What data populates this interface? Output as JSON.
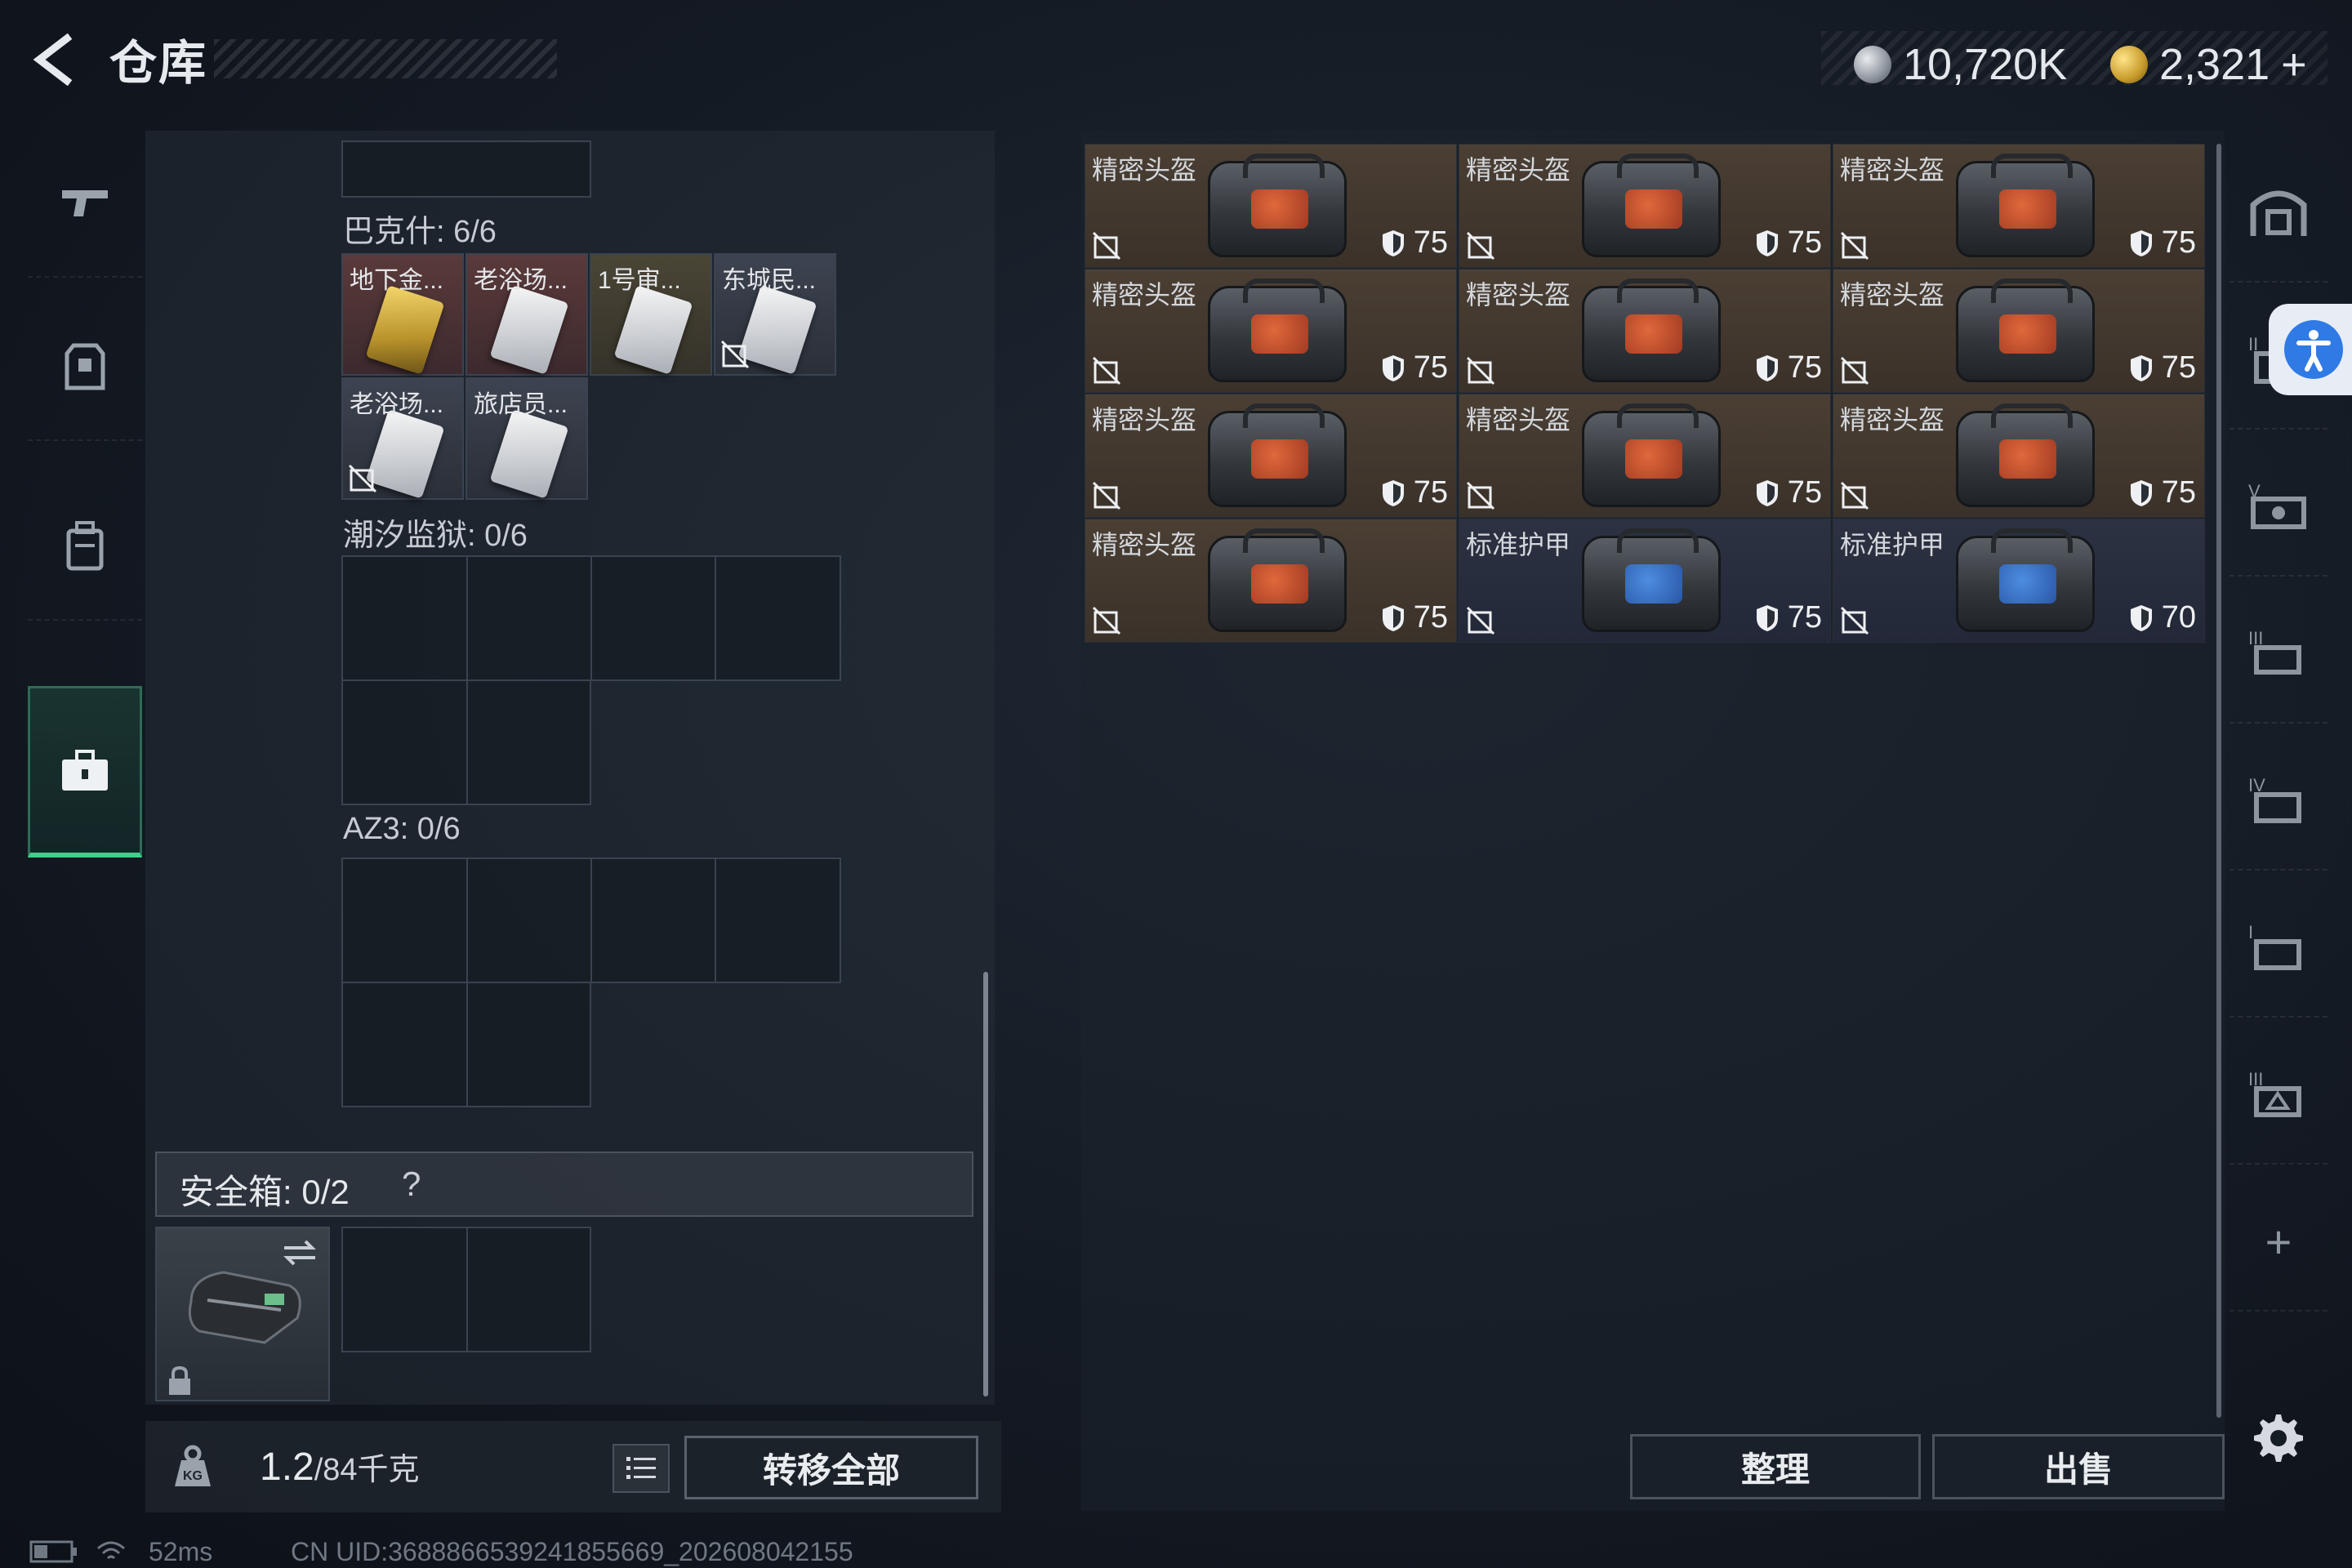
{
  "header": {
    "title": "仓库",
    "currency_silver": "10,720K",
    "currency_gold": "2,321",
    "add_symbol": "+"
  },
  "colors": {
    "accent_green": "#3fd08a",
    "helmet_cell": "#4b3f34",
    "armor_cell": "#2c3242"
  },
  "left_nav": {
    "items": [
      {
        "name": "weapons",
        "icon": "pistol-icon"
      },
      {
        "name": "armor",
        "icon": "vest-icon"
      },
      {
        "name": "backpack",
        "icon": "backpack-icon"
      },
      {
        "name": "toolbox",
        "icon": "briefcase-icon",
        "active": true
      }
    ]
  },
  "sections": {
    "bakesh": {
      "label": "巴克什: 6/6",
      "slots": [
        {
          "label": "地下金...",
          "type": "gold"
        },
        {
          "label": "老浴场...",
          "type": "card"
        },
        {
          "label": "1号审...",
          "type": "card"
        },
        {
          "label": "东城民...",
          "type": "card"
        },
        {
          "label": "老浴场...",
          "type": "card"
        },
        {
          "label": "旅店员...",
          "type": "card"
        }
      ]
    },
    "tide_prison": {
      "label": "潮汐监狱: 0/6"
    },
    "az3": {
      "label": "AZ3: 0/6"
    }
  },
  "safe_box": {
    "label": "安全箱: 0/2",
    "help": "?"
  },
  "footer": {
    "weight_current": "1.2",
    "weight_max": "/84千克",
    "transfer_label": "转移全部"
  },
  "grid": {
    "items": [
      {
        "name": "精密头盔",
        "value": "75",
        "kind": "helmet"
      },
      {
        "name": "精密头盔",
        "value": "75",
        "kind": "helmet"
      },
      {
        "name": "精密头盔",
        "value": "75",
        "kind": "helmet"
      },
      {
        "name": "精密头盔",
        "value": "75",
        "kind": "helmet"
      },
      {
        "name": "精密头盔",
        "value": "75",
        "kind": "helmet"
      },
      {
        "name": "精密头盔",
        "value": "75",
        "kind": "helmet"
      },
      {
        "name": "精密头盔",
        "value": "75",
        "kind": "helmet"
      },
      {
        "name": "精密头盔",
        "value": "75",
        "kind": "helmet"
      },
      {
        "name": "精密头盔",
        "value": "75",
        "kind": "helmet"
      },
      {
        "name": "精密头盔",
        "value": "75",
        "kind": "helmet"
      },
      {
        "name": "标准护甲",
        "value": "75",
        "kind": "armor"
      },
      {
        "name": "标准护甲",
        "value": "70",
        "kind": "armor"
      }
    ]
  },
  "actions": {
    "sort_label": "整理",
    "sell_label": "出售"
  },
  "right_nav": {
    "items": [
      "home-icon",
      "tier2-icon",
      "tier5-icon",
      "tier3-icon",
      "tier4-icon",
      "tier1-icon",
      "tier3b-icon",
      "add-icon"
    ],
    "add_symbol": "+"
  },
  "status_bar": {
    "ping": "52ms",
    "uid": "CN UID:3688866539241855669_202608042155"
  }
}
